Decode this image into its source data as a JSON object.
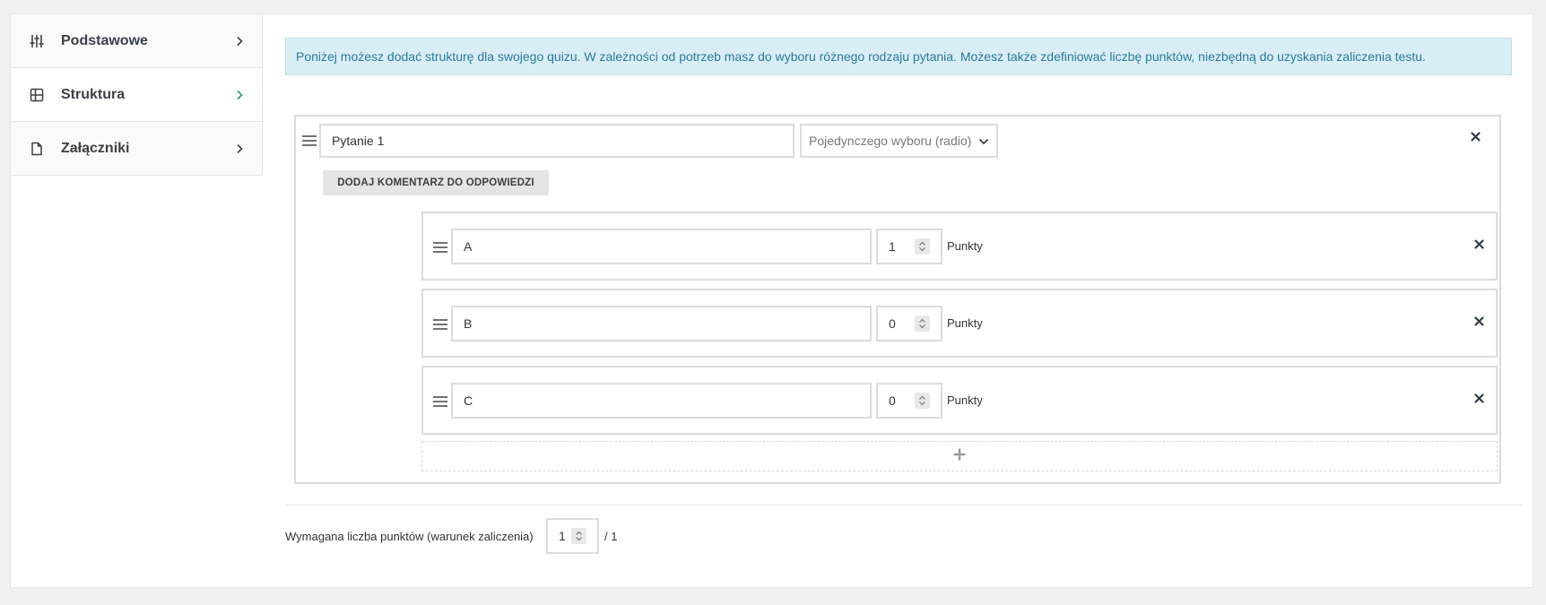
{
  "sidebar": {
    "items": [
      {
        "label": "Podstawowe",
        "icon": "sliders-icon",
        "active": false
      },
      {
        "label": "Struktura",
        "icon": "grid-icon",
        "active": true
      },
      {
        "label": "Załączniki",
        "icon": "file-icon",
        "active": false
      }
    ]
  },
  "info_text": "Poniżej możesz dodać strukturę dla swojego quizu. W zależności od potrzeb masz do wyboru różnego rodzaju pytania. Możesz także zdefiniować liczbę punktów, niezbędną do uzyskania zaliczenia testu.",
  "question": {
    "title": "Pytanie 1",
    "type": "Pojedynczego wyboru (radio)",
    "comment_button": "DODAJ KOMENTARZ DO ODPOWIEDZI",
    "answers": [
      {
        "text": "A",
        "points": "1",
        "unit": "Punkty"
      },
      {
        "text": "B",
        "points": "0",
        "unit": "Punkty"
      },
      {
        "text": "C",
        "points": "0",
        "unit": "Punkty"
      }
    ]
  },
  "requirement": {
    "label": "Wymagana liczba punktów (warunek zaliczenia)",
    "value": "1",
    "total": "/ 1"
  },
  "colors": {
    "accent_green": "#2a9d6b",
    "info_bg": "#d8edf5",
    "info_text": "#2a7b99"
  }
}
